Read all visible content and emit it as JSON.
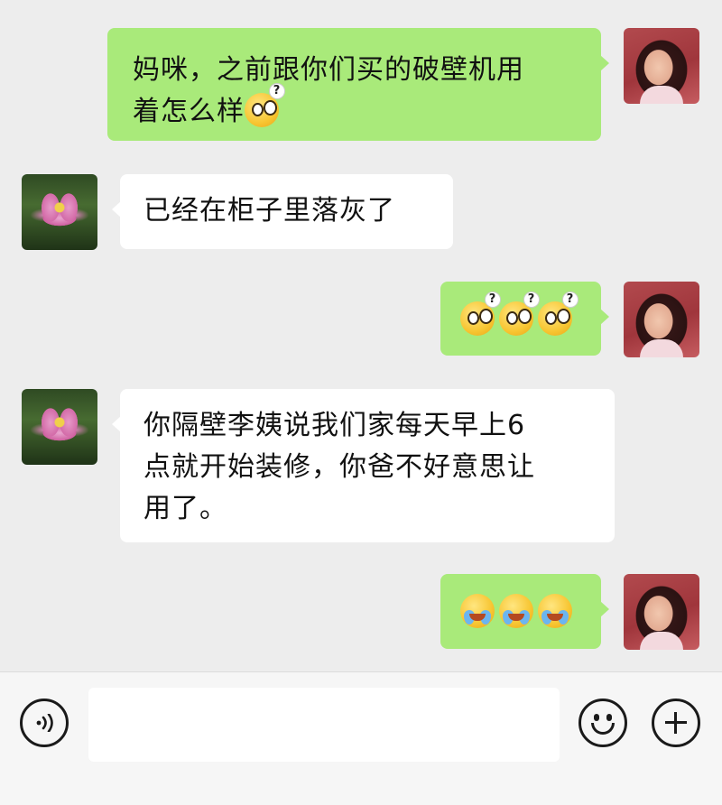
{
  "messages": [
    {
      "side": "out",
      "text": "妈咪，之前跟你们买的破壁机用着怎么样",
      "emoji": [
        "confused-face"
      ]
    },
    {
      "side": "in",
      "text": "已经在柜子里落灰了"
    },
    {
      "side": "out",
      "text": "",
      "emoji": [
        "confused-face",
        "confused-face",
        "confused-face"
      ]
    },
    {
      "side": "in",
      "text": "你隔壁李姨说我们家每天早上6点就开始装修，你爸不好意思让用了。"
    },
    {
      "side": "out",
      "text": "",
      "emoji": [
        "crying-face",
        "crying-face",
        "crying-face"
      ]
    }
  ],
  "bubble_lines": {
    "m1_line1": "妈咪，之前跟你们买的破壁机用",
    "m1_line2": "着怎么样",
    "m2": "已经在柜子里落灰了",
    "m4_line1": "你隔壁李姨说我们家每天早上6",
    "m4_line2": "点就开始装修，你爸不好意思让",
    "m4_line3": "用了。"
  },
  "input_bar": {
    "text_value": "",
    "voice_icon": "voice-icon",
    "emoji_icon": "emoji-icon",
    "plus_icon": "plus-icon"
  },
  "colors": {
    "background": "#ededed",
    "outgoing_bubble": "#a9ea7a",
    "incoming_bubble": "#ffffff"
  }
}
